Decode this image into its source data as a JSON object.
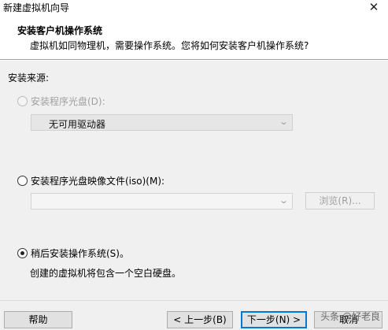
{
  "window": {
    "title": "新建虚拟机向导",
    "close_glyph": "✕"
  },
  "header": {
    "title": "安装客户机操作系统",
    "subtitle": "虚拟机如同物理机，需要操作系统。您将如何安装客户机操作系统?"
  },
  "install_source": {
    "label": "安装来源:",
    "options": [
      {
        "label": "安装程序光盘(D):",
        "selected": false,
        "enabled": false
      },
      {
        "label": "安装程序光盘映像文件(iso)(M):",
        "selected": false,
        "enabled": true
      },
      {
        "label": "稍后安装操作系统(S)。",
        "selected": true,
        "enabled": true
      }
    ],
    "drive_select": {
      "value": "无可用驱动器",
      "enabled": false
    },
    "iso_select": {
      "value": "",
      "enabled": false
    },
    "browse_button": {
      "label": "浏览(R)...",
      "enabled": false
    },
    "later_note": "创建的虚拟机将包含一个空白硬盘。"
  },
  "footer": {
    "help_label": "帮助",
    "back_label": "< 上一步(B)",
    "next_label": "下一步(N) >",
    "cancel_label": "取消"
  },
  "watermark": "头条 @好老良"
}
